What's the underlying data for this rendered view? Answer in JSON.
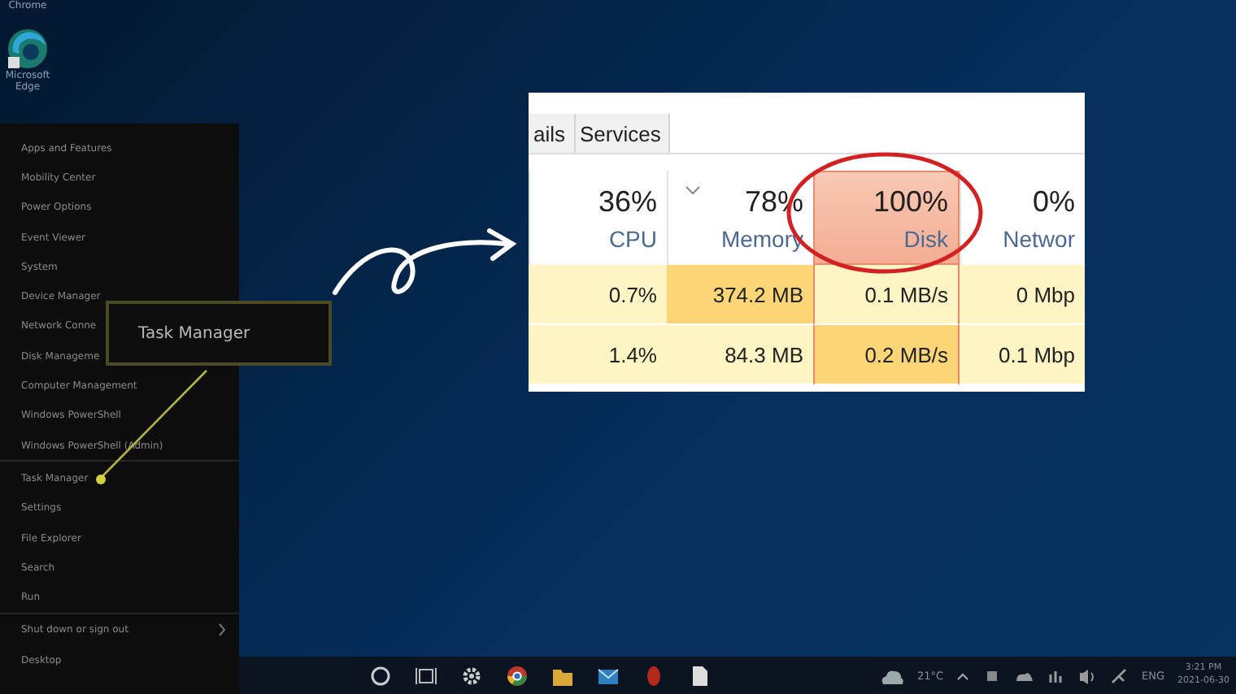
{
  "desktop_icons": [
    {
      "label": "Chrome"
    },
    {
      "label": "Microsoft Edge"
    }
  ],
  "menu": {
    "groups": [
      [
        {
          "label": "Apps and Features",
          "submenu": false
        },
        {
          "label": "Mobility Center",
          "submenu": false
        },
        {
          "label": "Power Options",
          "submenu": false
        },
        {
          "label": "Event Viewer",
          "submenu": false
        },
        {
          "label": "System",
          "submenu": false
        },
        {
          "label": "Device Manager",
          "submenu": false
        },
        {
          "label": "Network Conne",
          "submenu": false
        },
        {
          "label": "Disk Manageme",
          "submenu": false
        },
        {
          "label": "Computer Management",
          "submenu": false
        },
        {
          "label": "Windows PowerShell",
          "submenu": false
        },
        {
          "label": "Windows PowerShell (Admin)",
          "submenu": false
        }
      ],
      [
        {
          "label": "Task Manager",
          "submenu": false
        },
        {
          "label": "Settings",
          "submenu": false
        },
        {
          "label": "File Explorer",
          "submenu": false
        },
        {
          "label": "Search",
          "submenu": false
        },
        {
          "label": "Run",
          "submenu": false
        }
      ],
      [
        {
          "label": "Shut down or sign out",
          "submenu": true
        },
        {
          "label": "Desktop",
          "submenu": false
        }
      ]
    ]
  },
  "callout": {
    "text": "Task Manager"
  },
  "task_manager": {
    "tabs": [
      {
        "label": "ails"
      },
      {
        "label": "Services"
      }
    ],
    "columns": [
      {
        "value": "36%",
        "label": "CPU",
        "sorted": false,
        "highlighted": false
      },
      {
        "value": "78%",
        "label": "Memory",
        "sorted": true,
        "highlighted": false
      },
      {
        "value": "100%",
        "label": "Disk",
        "sorted": false,
        "highlighted": true
      },
      {
        "value": "0%",
        "label": "Networ",
        "sorted": false,
        "highlighted": false
      }
    ],
    "rows": [
      [
        {
          "text": "0.7%",
          "color": "#fff4c4"
        },
        {
          "text": "374.2 MB",
          "color": "#fcd576"
        },
        {
          "text": "0.1 MB/s",
          "color": "#fff4c4"
        },
        {
          "text": "0 Mbp",
          "color": "#fff4c4"
        }
      ],
      [
        {
          "text": "1.4%",
          "color": "#fff4c4"
        },
        {
          "text": "84.3 MB",
          "color": "#fff4c4"
        },
        {
          "text": "0.2 MB/s",
          "color": "#fcd576"
        },
        {
          "text": "0.1 Mbp",
          "color": "#fff4c4"
        }
      ]
    ]
  },
  "taskbar": {
    "temperature": "21°C",
    "language": "ENG",
    "time": "3:21 PM",
    "date": "2021-06-30"
  }
}
